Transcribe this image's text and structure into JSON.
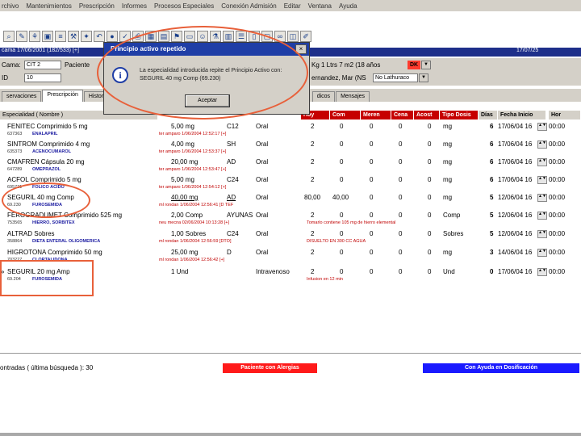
{
  "menu": [
    "rchivo",
    "Mantenimientos",
    "Prescripción",
    "Informes",
    "Procesos Especiales",
    "Conexión Admisión",
    "Editar",
    "Ventana",
    "Ayuda"
  ],
  "band": {
    "left": "cama 17/06/2001 (182/533) [+]",
    "right": "17/07/25"
  },
  "patient": {
    "label_cama": "Cama:",
    "cama_value": "CIT 2",
    "label_paciente": "Paciente",
    "label_id": "ID",
    "id_value": "10",
    "right_text": "Kg   1 Ltrs   7   m2   (18 años",
    "alert": "DK",
    "name_text": "ernandez, Mar  (NS",
    "insurance": "No Lathuraco"
  },
  "tabs": [
    "servaciones",
    "Prescripción",
    "Histori",
    "dicos",
    "Mensajes"
  ],
  "columns": {
    "especialidad": "Especialidad ( Nombre )",
    "hoy": "Hoy",
    "com": "Com",
    "meren": "Meren",
    "cena": "Cena",
    "acost": "Acost",
    "tipo": "Tipo Dosis",
    "dias": "Días",
    "fecha": "Fecha Inicio",
    "hora": "Hor"
  },
  "rows": [
    {
      "med": "FENITEC Comprimido 5 mg",
      "code": "637363",
      "sub": "ENALAPRIL",
      "dose": "5,00 mg",
      "freq": "C12",
      "via": "Oral",
      "info": "ter amparo 1/06/2004 12:52:17 [+]",
      "hoy": "2",
      "com": "0",
      "meren": "0",
      "cena": "0",
      "acost": "0",
      "note": "",
      "unit": "mg",
      "days": "6",
      "date": "17/06/04 16",
      "time": "00:00",
      "mark": ""
    },
    {
      "med": "SINTROM Comprimido 4 mg",
      "code": "635373",
      "sub": "ACENOCUMAROL",
      "dose": "4,00 mg",
      "freq": "SH",
      "via": "Oral",
      "info": "ter amparo 1/06/2004 12:53:37 [+]",
      "hoy": "2",
      "com": "0",
      "meren": "0",
      "cena": "0",
      "acost": "0",
      "note": "",
      "unit": "mg",
      "days": "6",
      "date": "17/06/04 16",
      "time": "00:00",
      "mark": ""
    },
    {
      "med": "CMAFREN Cápsula 20 mg",
      "code": "647289",
      "sub": "OMEPRAZOL",
      "dose": "20,00 mg",
      "freq": "AD",
      "via": "Oral",
      "info": "ter amparo 1/06/2004 12:53:47 [+]",
      "hoy": "2",
      "com": "0",
      "meren": "0",
      "cena": "0",
      "acost": "0",
      "note": "",
      "unit": "mg",
      "days": "6",
      "date": "17/06/04 16",
      "time": "00:00",
      "mark": ""
    },
    {
      "med": "ACFOL Comprimido 5 mg",
      "code": "695721",
      "sub": "FOLICO ACIDO",
      "dose": "5,00 mg",
      "freq": "C24",
      "via": "Oral",
      "info": "ter amparo 1/06/2004 12:54:12 [+]",
      "hoy": "2",
      "com": "0",
      "meren": "0",
      "cena": "0",
      "acost": "0",
      "note": "",
      "unit": "mg",
      "days": "6",
      "date": "17/06/04 16",
      "time": "00:00",
      "mark": ""
    },
    {
      "med": "SEGURIL 40 mg Comp",
      "code": "69.230",
      "sub": "FUROSEMIDA",
      "dose": "40,00 mg",
      "freq": "AD",
      "via": "Oral",
      "info": "ml rondan 1/06/2004 12:56:41 [D TEF",
      "hoy": "80,00",
      "com": "40,00",
      "meren": "0",
      "cena": "0",
      "acost": "0",
      "note": "",
      "unit": "mg",
      "days": "5",
      "date": "12/06/04 16",
      "time": "00:00",
      "mark": ""
    },
    {
      "med": "FEROGRADUMET Comprimido 525 mg",
      "code": "753565",
      "sub": "HIERRO, SORBITEX",
      "dose": "2,00 Comp",
      "freq": "AYUNAS",
      "via": "Oral",
      "info": "neu mecna 02/06/2004 10:13:28 [+]",
      "hoy": "2",
      "com": "0",
      "meren": "0",
      "cena": "0",
      "acost": "0",
      "note": "Tomarlo contiene 105 mg de hierro elemental",
      "unit": "Comp",
      "days": "5",
      "date": "12/06/04 16",
      "time": "00:00",
      "mark": ""
    },
    {
      "med": "ALTRAD Sobres",
      "code": "358864",
      "sub": "DIETA ENTERAL OLIGOMERICA",
      "dose": "1,00 Sobres",
      "freq": "C24",
      "via": "Oral",
      "info": "ml rondan 1/06/2004 12:56:59 [DTO]",
      "hoy": "2",
      "com": "0",
      "meren": "0",
      "cena": "0",
      "acost": "0",
      "note": "DISUELTO EN 300 CC AGUA",
      "unit": "Sobres",
      "days": "5",
      "date": "12/06/04 16",
      "time": "00:00",
      "mark": ""
    },
    {
      "med": "HIGROTONA Comprimido 50 mg",
      "code": "703227",
      "sub": "CLORTALIDONA",
      "dose": "25,00 mg",
      "freq": "D",
      "via": "Oral",
      "info": "ml rondan 1/06/2004 12:56:42 [+]",
      "hoy": "2",
      "com": "0",
      "meren": "0",
      "cena": "0",
      "acost": "0",
      "note": "",
      "unit": "mg",
      "days": "3",
      "date": "14/06/04 16",
      "time": "00:00",
      "mark": ""
    },
    {
      "med": "SEGURIL 20 mg Amp",
      "code": "69.204",
      "sub": "FUROSEMIDA",
      "dose": "1 Und",
      "freq": "",
      "via": "Intravenoso",
      "info": "",
      "hoy": "2",
      "com": "0",
      "meren": "0",
      "cena": "0",
      "acost": "0",
      "note": "Infusion en 12 min",
      "unit": "Und",
      "days": "0",
      "date": "17/06/04 16",
      "time": "00:00",
      "mark": "»"
    }
  ],
  "dialog": {
    "title": "Principio activo repetido",
    "close": "×",
    "message": "La especialidad introducida repite el Principio Activo con: SEGURIL 40 mg Comp (69.230)",
    "ok": "Aceptar"
  },
  "status": {
    "text": "ontradas ( última búsqueda ): 30",
    "alergias": "Paciente con Alergias",
    "ayuda": "Con Ayuda en Dosificación"
  },
  "colors": {
    "header_red": "#c60000",
    "band_blue": "#1e2f8a",
    "annotation": "#e8603a",
    "alert_red": "#ff1a1a",
    "help_blue": "#1a1aff"
  }
}
